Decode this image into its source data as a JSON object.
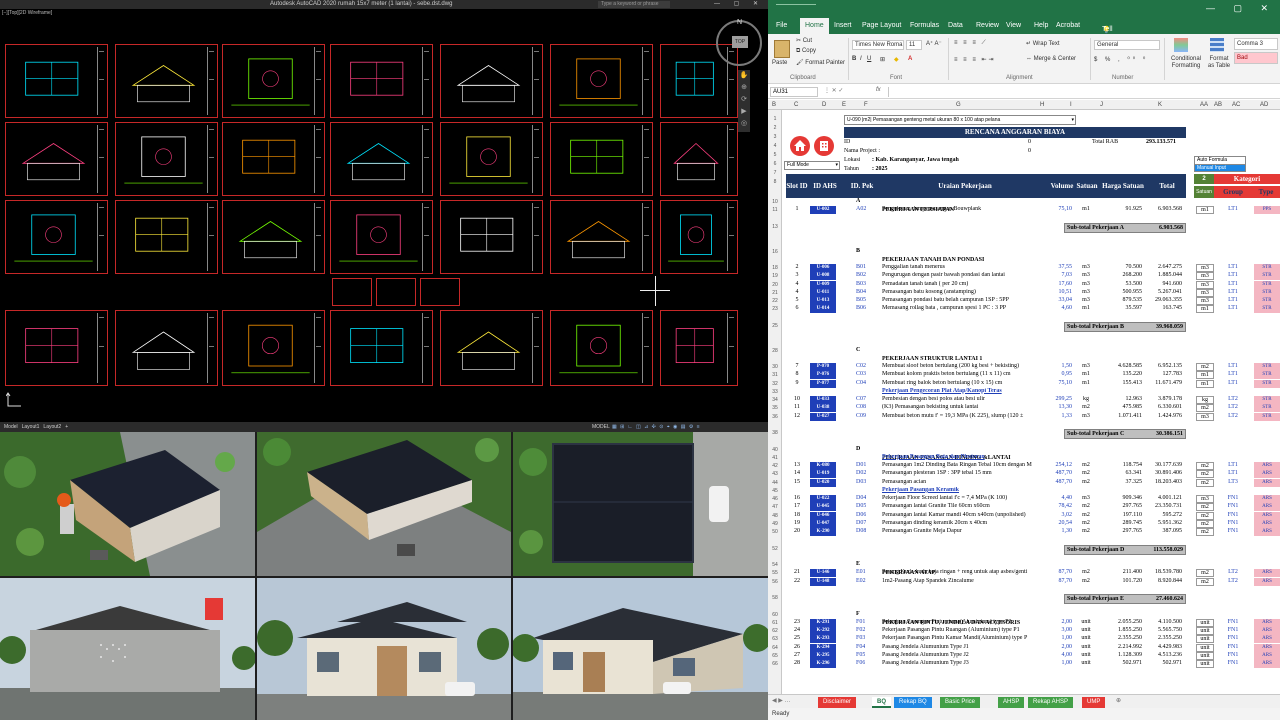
{
  "autocad": {
    "title": "Autodesk AutoCAD 2020   rumah 15x7 meter (1 lantai) - sebe.dst.dwg",
    "search_placeholder": "Type a keyword or phrase",
    "viewport_label": "[−][Top][2D Wireframe]",
    "compass_north": "N",
    "compass_top": "TOP",
    "status_tabs": [
      "Model",
      "Layout1",
      "Layout2",
      "+"
    ],
    "status_mode": "MODEL"
  },
  "excel": {
    "menu": [
      "File",
      "Home",
      "Insert",
      "Page Layout",
      "Formulas",
      "Data",
      "Review",
      "View",
      "Help",
      "Acrobat"
    ],
    "tell_me": "Tell me what you want to do",
    "ribbon": {
      "cut": "Cut",
      "copy": "Copy",
      "format_painter": "Format Painter",
      "paste": "Paste",
      "clipboard": "Clipboard",
      "font_name": "Times New Roma",
      "font_size": "11",
      "font_group": "Font",
      "wrap_text": "Wrap Text",
      "merge_center": "Merge & Center",
      "alignment_group": "Alignment",
      "number_format": "General",
      "number_group": "Number",
      "conditional": "Conditional Formatting",
      "format_table": "Format as Table",
      "style_comma": "Comma 3",
      "style_bad": "Bad"
    },
    "name_box": "AU31",
    "formula_symbol": "fx",
    "columns": [
      "B",
      "C",
      "D",
      "E",
      "F",
      "G",
      "H",
      "I",
      "J",
      "K",
      "AA",
      "AB",
      "AC",
      "AD"
    ],
    "item_dropdown": "U-090 |m2| Pemasangan genteng metal ukuran 80 x 100 atap pelana",
    "header_band": "RENCANA ANGGARAN BIAYA",
    "id_label": "ID",
    "id_value": "0",
    "project_label": "Nama Project :",
    "project_value": "0",
    "total_rab_label": "Total RAB",
    "total_rab_value": "293.133.571",
    "lokasi_label": "Lokasi",
    "lokasi_value": ": Kab. Karanganyar, Jawa tengah",
    "tahun_label": "Tahun",
    "tahun_value": ": 2025",
    "mode_dropdown": "Full Mode",
    "auto_formula": "Auto Formula",
    "manual_input": "Manual Input",
    "table_headers": [
      "Slot ID",
      "ID AHS",
      "ID. Pek",
      "Uraian Pekerjaan",
      "Volume",
      "Satuan",
      "Harga Satuan",
      "Total"
    ],
    "kategori_count": "2",
    "kategori_label": "Kategori",
    "satuan_label": "Satuan",
    "group_label": "Group",
    "type_label": "Type",
    "rows": [
      {
        "r": "10",
        "kind": "section",
        "code": "A",
        "text": "PEKERJAAN PERSIAPAN"
      },
      {
        "r": "11",
        "slot": "1",
        "ahs": "U-002",
        "pek": "A02",
        "text": "Pengukuran dan pemasangan  Bouwplank",
        "vol": "75,10",
        "sat": "m1",
        "harga": "91.925",
        "total": "6.903.568",
        "sat2": "m1",
        "grp": "LT1",
        "type": "PPS"
      },
      {
        "r": "13",
        "kind": "subtotal",
        "text": "Sub-total Pekerjaan A",
        "value": "6.903.568"
      },
      {
        "r": "16",
        "kind": "section",
        "code": "B",
        "text": "PEKERJAAN TANAH DAN PONDASI"
      },
      {
        "r": "18",
        "slot": "2",
        "ahs": "U-006",
        "pek": "B01",
        "text": "Penggalian  tanah menerus",
        "vol": "37,55",
        "sat": "m3",
        "harga": "70.500",
        "total": "2.647.275",
        "sat2": "m3",
        "grp": "LT1",
        "type": "STR"
      },
      {
        "r": "19",
        "slot": "3",
        "ahs": "U-008",
        "pek": "B02",
        "text": "Pengurugan dengan pasir bawah pondasi dan lantai",
        "vol": "7,03",
        "sat": "m3",
        "harga": "268.200",
        "total": "1.885.044",
        "sat2": "m3",
        "grp": "LT1",
        "type": "STR"
      },
      {
        "r": "20",
        "slot": "4",
        "ahs": "U-009",
        "pek": "B03",
        "text": "Pemadatan tanah  tanah ( per 20 cm)",
        "vol": "17,60",
        "sat": "m3",
        "harga": "53.500",
        "total": "941.600",
        "sat2": "m3",
        "grp": "LT1",
        "type": "STR"
      },
      {
        "r": "21",
        "slot": "4",
        "ahs": "U-011",
        "pek": "B04",
        "text": "Pemasangan  batu kosong (anstamping)",
        "vol": "10,51",
        "sat": "m3",
        "harga": "500.955",
        "total": "5.267.041",
        "sat2": "m3",
        "grp": "LT1",
        "type": "STR"
      },
      {
        "r": "22",
        "slot": "5",
        "ahs": "U-013",
        "pek": "B05",
        "text": "Pemasangan pondasi batu belah campuran 1SP : 5PP",
        "vol": "33,04",
        "sat": "m3",
        "harga": "879.535",
        "total": "29.063.355",
        "sat2": "m3",
        "grp": "LT1",
        "type": "STR"
      },
      {
        "r": "23",
        "slot": "6",
        "ahs": "U-014",
        "pek": "B06",
        "text": "Memasang rollag bata , campuran spesi 1 PC : 3 PP",
        "vol": "4,60",
        "sat": "m1",
        "harga": "35.597",
        "total": "163.745",
        "sat2": "m1",
        "grp": "LT1",
        "type": "STR"
      },
      {
        "r": "25",
        "kind": "subtotal",
        "text": "Sub-total Pekerjaan B",
        "value": "39.968.059"
      },
      {
        "r": "28",
        "kind": "section",
        "code": "C",
        "text": "PEKERJAAN STRUKTUR LANTAI 1"
      },
      {
        "r": "30",
        "slot": "7",
        "ahs": "P-070",
        "pek": "C02",
        "text": "Membuat sloof beton bertulang (200 kg besi + bekisting)",
        "vol": "1,50",
        "sat": "m3",
        "harga": "4.628.585",
        "total": "6.952.135",
        "sat2": "m2",
        "grp": "LT1",
        "type": "STR"
      },
      {
        "r": "31",
        "slot": "8",
        "ahs": "P-076",
        "pek": "C03",
        "text": "Membuat  kolom praktis beton bertulang (11 x 11) cm",
        "vol": "0,95",
        "sat": "m1",
        "harga": "135.220",
        "total": "127.783",
        "sat2": "m1",
        "grp": "LT1",
        "type": "STR"
      },
      {
        "r": "32",
        "slot": "9",
        "ahs": "P-077",
        "pek": "C04",
        "text": "Membuat  ring balok beton bertulang (10 x 15) cm",
        "vol": "75,10",
        "sat": "m1",
        "harga": "155.413",
        "total": "11.671.479",
        "sat2": "m1",
        "grp": "LT1",
        "type": "STR"
      },
      {
        "r": "33",
        "kind": "subsection",
        "text": "Pekerjaan Pengecoran Plat Atap/Kanopi Teras"
      },
      {
        "r": "34",
        "slot": "10",
        "ahs": "U-033",
        "pek": "C07",
        "text": "Pembesian  dengan besi polos atau besi ulir",
        "vol": "299,25",
        "sat": "kg",
        "harga": "12.963",
        "total": "3.879.178",
        "sat2": "kg",
        "grp": "LT2",
        "type": "STR"
      },
      {
        "r": "35",
        "slot": "11",
        "ahs": "U-038",
        "pek": "C08",
        "text": "(K3) Pemasangan  bekisting untuk lantai",
        "vol": "13,30",
        "sat": "m2",
        "harga": "475.985",
        "total": "6.330.601",
        "sat2": "m2",
        "grp": "LT2",
        "type": "STR"
      },
      {
        "r": "36",
        "slot": "12",
        "ahs": "U-027",
        "pek": "C09",
        "text": "Membuat beton mutu f' = 19,3 MPa (K 225), slump (120 ±",
        "vol": "1,33",
        "sat": "m3",
        "harga": "1.071.411",
        "total": "1.424.976",
        "sat2": "m3",
        "grp": "LT2",
        "type": "STR"
      },
      {
        "r": "38",
        "kind": "subtotal",
        "text": "Sub-total Pekerjaan C",
        "value": "30.386.151"
      },
      {
        "r": "40",
        "kind": "section",
        "code": "D",
        "text": "PEKERJAAN PASANGAN DINDING &LANTAI"
      },
      {
        "r": "41",
        "kind": "subsection",
        "text": "Pekerjaan Pasangan Bata dan Plesteran"
      },
      {
        "r": "42",
        "slot": "13",
        "ahs": "K-080",
        "pek": "D01",
        "text": "Pemasangan 1m2 Dinding Bata Ringan Tebal 10cm dengan M",
        "vol": "254,12",
        "sat": "m2",
        "harga": "118.754",
        "total": "30.177.639",
        "sat2": "m2",
        "grp": "LT1",
        "type": "ARS"
      },
      {
        "r": "43",
        "slot": "14",
        "ahs": "U-019",
        "pek": "D02",
        "text": "Pemasangan  plesteran 1SP : 3PP tebal 15 mm",
        "vol": "487,70",
        "sat": "m2",
        "harga": "63.341",
        "total": "30.891.406",
        "sat2": "m2",
        "grp": "LT1",
        "type": "ARS"
      },
      {
        "r": "44",
        "slot": "15",
        "ahs": "U-020",
        "pek": "D03",
        "text": "Pemasangan  acian",
        "vol": "487,70",
        "sat": "m2",
        "harga": "37.325",
        "total": "18.203.403",
        "sat2": "m2",
        "grp": "LT3",
        "type": "ARS"
      },
      {
        "r": "45",
        "kind": "subsection",
        "text": "Pekerjaan Pasangan Keramik"
      },
      {
        "r": "46",
        "slot": "16",
        "ahs": "U-022",
        "pek": "D04",
        "text": "Pekerjaan Floor Screed lantai  f'c = 7,4 MPa (K 100)",
        "vol": "4,40",
        "sat": "m3",
        "harga": "909.346",
        "total": "4.001.121",
        "sat2": "m3",
        "grp": "FN1",
        "type": "ARS"
      },
      {
        "r": "47",
        "slot": "17",
        "ahs": "U-045",
        "pek": "D05",
        "text": "Pemasangan lantai Granite Tile 60cm x60cm",
        "vol": "78,42",
        "sat": "m2",
        "harga": "297.765",
        "total": "23.350.731",
        "sat2": "m2",
        "grp": "FN1",
        "type": "ARS"
      },
      {
        "r": "48",
        "slot": "18",
        "ahs": "U-046",
        "pek": "D06",
        "text": "Pemasangan  lantai Kamar mandi 40cm x40cm (unpolished)",
        "vol": "3,02",
        "sat": "m2",
        "harga": "197.110",
        "total": "595.272",
        "sat2": "m2",
        "grp": "FN1",
        "type": "ARS"
      },
      {
        "r": "49",
        "slot": "19",
        "ahs": "U-047",
        "pek": "D07",
        "text": "Pemasangan  dinding keramik  20cm x 40cm",
        "vol": "20,54",
        "sat": "m2",
        "harga": "289.745",
        "total": "5.951.362",
        "sat2": "m2",
        "grp": "FN1",
        "type": "ARS"
      },
      {
        "r": "50",
        "slot": "20",
        "ahs": "K-290",
        "pek": "D08",
        "text": "Pemasangan Granite Meja Dapur",
        "vol": "1,30",
        "sat": "m2",
        "harga": "297.765",
        "total": "387.095",
        "sat2": "m2",
        "grp": "FN1",
        "type": "ARS"
      },
      {
        "r": "52",
        "kind": "subtotal",
        "text": "Sub-total Pekerjaan D",
        "value": "113.558.029"
      },
      {
        "r": "54",
        "kind": "section",
        "code": "E",
        "text": "PEKERJAAN ATAP"
      },
      {
        "r": "55",
        "slot": "21",
        "ahs": "U-146",
        "pek": "E01",
        "text": "Pasang Kuda-kuda baja ringan + reng untuk atap asbes/genti",
        "vol": "87,70",
        "sat": "m2",
        "harga": "211.400",
        "total": "18.539.780",
        "sat2": "m2",
        "grp": "LT2",
        "type": "ARS"
      },
      {
        "r": "56",
        "slot": "22",
        "ahs": "U-148",
        "pek": "E02",
        "text": "1m2-Pasang Atap Spandek Zincalume",
        "vol": "87,70",
        "sat": "m2",
        "harga": "101.720",
        "total": "8.920.844",
        "sat2": "m2",
        "grp": "LT2",
        "type": "ARS"
      },
      {
        "r": "58",
        "kind": "subtotal",
        "text": "Sub-total Pekerjaan E",
        "value": "27.460.624"
      },
      {
        "r": "60",
        "kind": "section",
        "code": "F",
        "text": "PEKERJAAN PINTU, JENDELA DAN ACCESORIS"
      },
      {
        "r": "61",
        "slot": "23",
        "ahs": "K-291",
        "pek": "F01",
        "text": "Pekerjaan Pasangan Pintu utama(Aluminium)  type P3",
        "vol": "2,00",
        "sat": "unit",
        "harga": "2.055.250",
        "total": "4.110.500",
        "sat2": "unit",
        "grp": "FN1",
        "type": "ARS"
      },
      {
        "r": "62",
        "slot": "24",
        "ahs": "K-292",
        "pek": "F02",
        "text": "Pekerjaan Pasangan Pintu Ruangan (Aluminium)  type P1",
        "vol": "3,00",
        "sat": "unit",
        "harga": "1.855.250",
        "total": "5.565.750",
        "sat2": "unit",
        "grp": "FN1",
        "type": "ARS"
      },
      {
        "r": "63",
        "slot": "25",
        "ahs": "K-293",
        "pek": "F03",
        "text": "Pekerjaan Pasangan Pintu Kamar Mandi(Aluminium)  type P",
        "vol": "1,00",
        "sat": "unit",
        "harga": "2.355.250",
        "total": "2.355.250",
        "sat2": "unit",
        "grp": "FN1",
        "type": "ARS"
      },
      {
        "r": "64",
        "slot": "26",
        "ahs": "K-294",
        "pek": "F04",
        "text": "Pasang Jendela Alumunium Type J1",
        "vol": "2,00",
        "sat": "unit",
        "harga": "2.214.992",
        "total": "4.429.983",
        "sat2": "unit",
        "grp": "FN1",
        "type": "ARS"
      },
      {
        "r": "65",
        "slot": "27",
        "ahs": "K-295",
        "pek": "F05",
        "text": "Pasang Jendela Alumunium Type J2",
        "vol": "4,00",
        "sat": "unit",
        "harga": "1.128.309",
        "total": "4.513.236",
        "sat2": "unit",
        "grp": "FN1",
        "type": "ARS"
      },
      {
        "r": "66",
        "slot": "28",
        "ahs": "K-296",
        "pek": "F06",
        "text": "Pasang Jendela Alumunium Type J3",
        "vol": "1,00",
        "sat": "unit",
        "harga": "502.971",
        "total": "502.971",
        "sat2": "unit",
        "grp": "FN1",
        "type": "ARS"
      }
    ],
    "sheet_tabs": [
      {
        "label": "Disclaimer",
        "color": "#e53935"
      },
      {
        "label": "BQ",
        "color": "#ffffff"
      },
      {
        "label": "Rekap BQ",
        "color": "#1e88e5"
      },
      {
        "label": "Basic Price",
        "color": "#43a047"
      },
      {
        "label": "AHSP",
        "color": "#43a047"
      },
      {
        "label": "Rekap AHSP",
        "color": "#43a047"
      },
      {
        "label": "UMP",
        "color": "#e53935"
      }
    ],
    "status": "Ready"
  }
}
